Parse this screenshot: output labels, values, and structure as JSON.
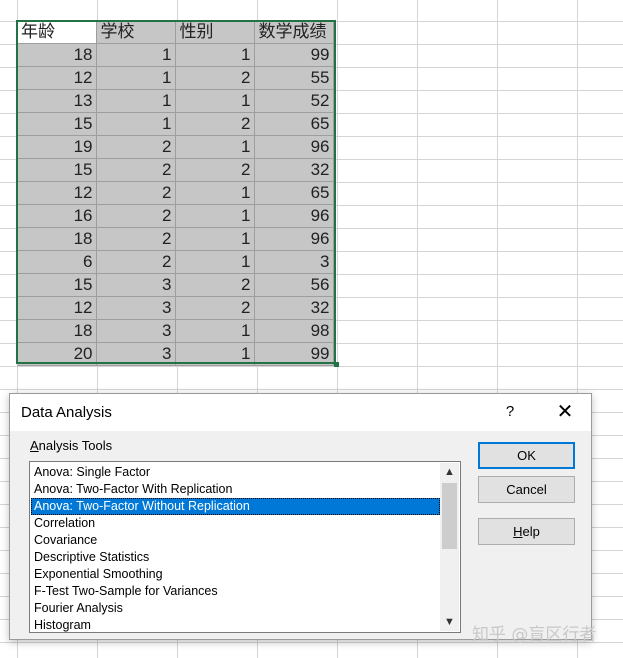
{
  "sheet": {
    "headers": [
      "年龄",
      "学校",
      "性别",
      "数学成绩"
    ],
    "rows": [
      [
        "18",
        "1",
        "1",
        "99"
      ],
      [
        "12",
        "1",
        "2",
        "55"
      ],
      [
        "13",
        "1",
        "1",
        "52"
      ],
      [
        "15",
        "1",
        "2",
        "65"
      ],
      [
        "19",
        "2",
        "1",
        "96"
      ],
      [
        "15",
        "2",
        "2",
        "32"
      ],
      [
        "12",
        "2",
        "1",
        "65"
      ],
      [
        "16",
        "2",
        "1",
        "96"
      ],
      [
        "18",
        "2",
        "1",
        "96"
      ],
      [
        "6",
        "2",
        "1",
        "3"
      ],
      [
        "15",
        "3",
        "2",
        "56"
      ],
      [
        "12",
        "3",
        "2",
        "32"
      ],
      [
        "18",
        "3",
        "1",
        "98"
      ],
      [
        "20",
        "3",
        "1",
        "99"
      ]
    ]
  },
  "dialog": {
    "title": "Data Analysis",
    "help_glyph": "?",
    "close_glyph": "✕",
    "tools_label_first": "A",
    "tools_label_rest": "nalysis Tools",
    "tools": [
      "Anova: Single Factor",
      "Anova: Two-Factor With Replication",
      "Anova: Two-Factor Without Replication",
      "Correlation",
      "Covariance",
      "Descriptive Statistics",
      "Exponential Smoothing",
      "F-Test Two-Sample for Variances",
      "Fourier Analysis",
      "Histogram"
    ],
    "selected_index": 2,
    "ok_label": "OK",
    "cancel_label": "Cancel",
    "help_label_first": "H",
    "help_label_rest": "elp"
  },
  "watermark": "知乎 @盲区行者",
  "colors": {
    "selection": "#0078d7",
    "range_border": "#217346",
    "cell_fill": "#c6c6c6"
  }
}
